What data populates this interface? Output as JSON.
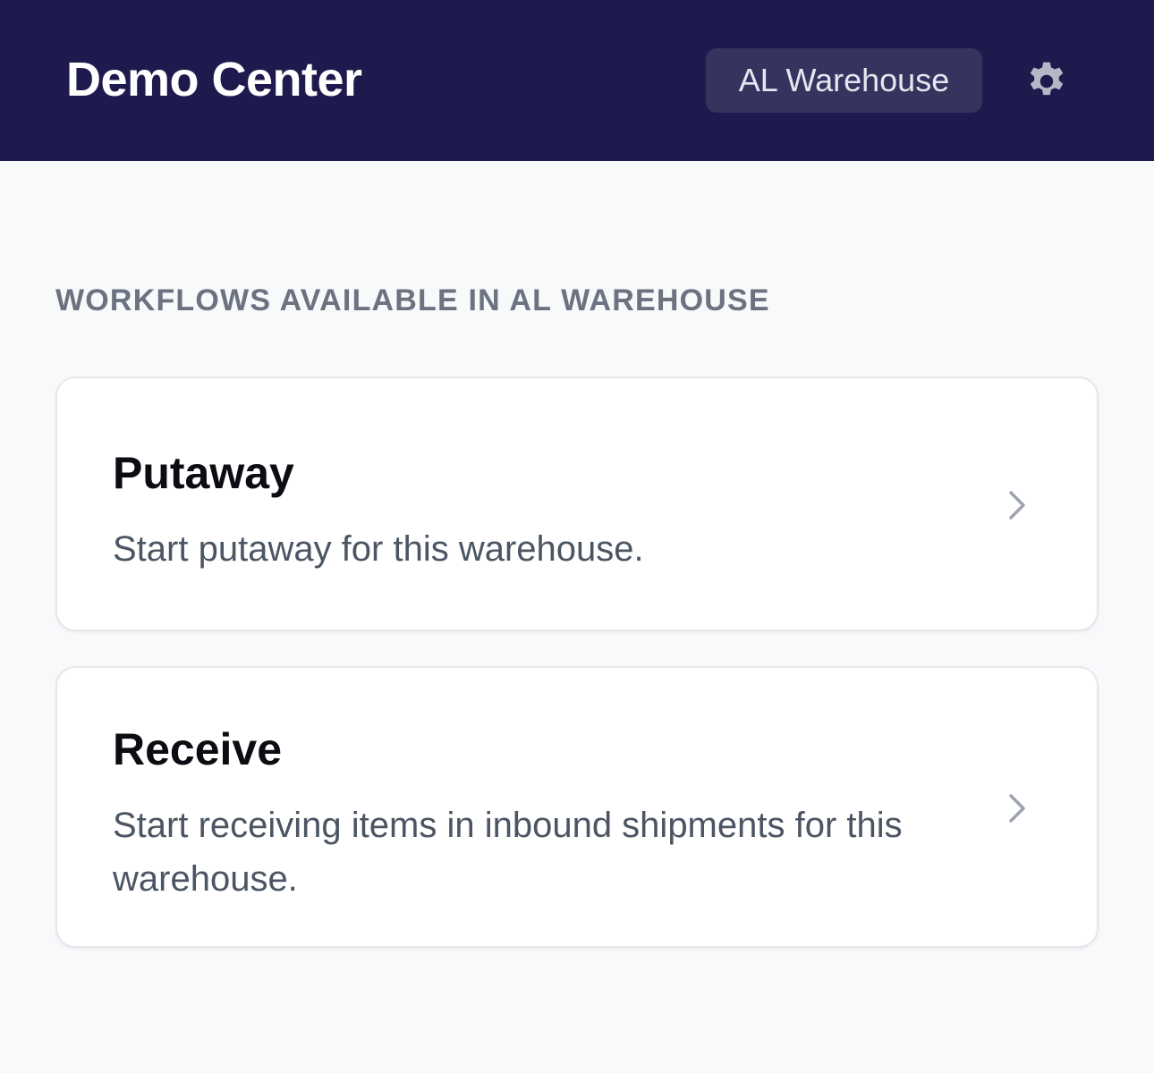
{
  "header": {
    "title": "Demo Center",
    "warehouse_button_label": "AL Warehouse",
    "settings_icon": "gear-icon"
  },
  "colors": {
    "header_bg": "#1f1a4e",
    "warehouse_button_bg": "#37335f",
    "page_bg": "#f8f9fb",
    "card_bg": "#ffffff",
    "section_label": "#6b7280",
    "card_title": "#0b0d12",
    "card_desc": "#4b5563",
    "chevron": "#9ca3af",
    "gear": "#b7b6c6"
  },
  "main": {
    "section_label": "WORKFLOWS AVAILABLE IN AL WAREHOUSE",
    "workflows": [
      {
        "title": "Putaway",
        "description": "Start putaway for this warehouse.",
        "icon": "chevron-right-icon"
      },
      {
        "title": "Receive",
        "description": "Start receiving items in inbound shipments for this warehouse.",
        "icon": "chevron-right-icon"
      }
    ]
  }
}
